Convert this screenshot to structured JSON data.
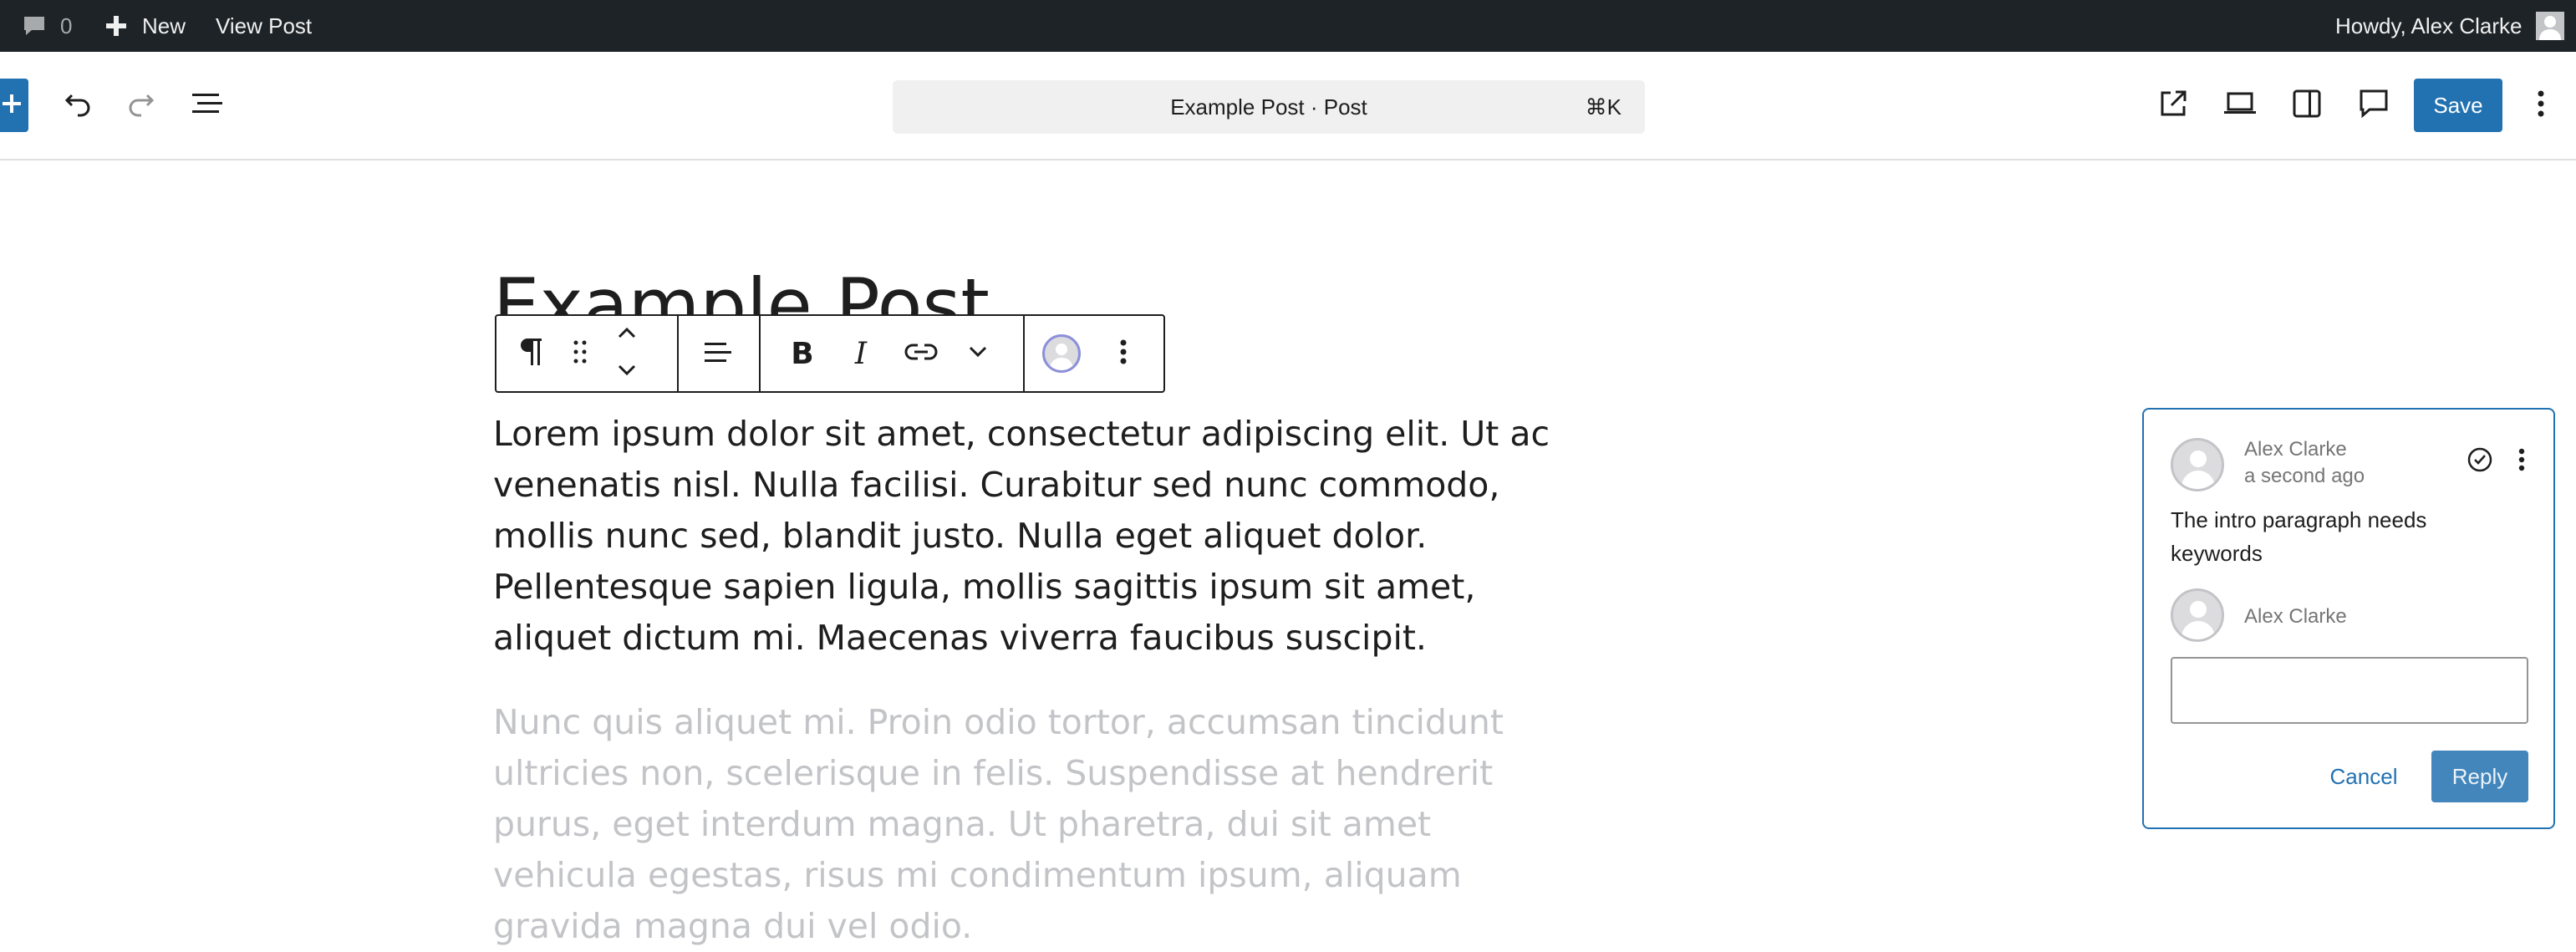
{
  "admin_bar": {
    "comments_count": "0",
    "new_label": "New",
    "view_post_label": "View Post",
    "howdy_label": "Howdy, Alex Clarke"
  },
  "header": {
    "document_title": "Example Post · Post",
    "shortcut": "⌘K",
    "save_label": "Save"
  },
  "post": {
    "title": "Example Post",
    "paragraph_1": "Lorem ipsum dolor sit amet, consectetur adipiscing elit. Ut ac venenatis nisl. Nulla facilisi. Curabitur sed nunc commodo, mollis nunc sed, blandit justo. Nulla eget aliquet dolor. Pellentesque sapien ligula, mollis sagittis ipsum sit amet, aliquet dictum mi. Maecenas viverra faucibus suscipit.",
    "paragraph_2": "Nunc quis aliquet mi. Proin odio tortor, accumsan tincidunt ultricies non, scelerisque in felis. Suspendisse at hendrerit purus, eget interdum magna. Ut pharetra, dui sit amet vehicula egestas, risus mi condimentum ipsum, aliquam gravida magna dui vel odio."
  },
  "comment": {
    "author": "Alex Clarke",
    "time": "a second ago",
    "text": "The intro paragraph needs keywords",
    "reply_author": "Alex Clarke",
    "cancel_label": "Cancel",
    "reply_label": "Reply"
  },
  "colors": {
    "accent": "#2271b1",
    "admin_bar": "#1d2327",
    "placeholder_text": "#c3c4c7"
  },
  "icons": {
    "block_toolbar": [
      "paragraph-icon",
      "drag-handle-icon",
      "move-up-icon",
      "move-down-icon",
      "align-icon",
      "bold-icon",
      "italic-icon",
      "link-icon",
      "more-rich-text-icon",
      "avatar-icon",
      "options-icon"
    ]
  }
}
